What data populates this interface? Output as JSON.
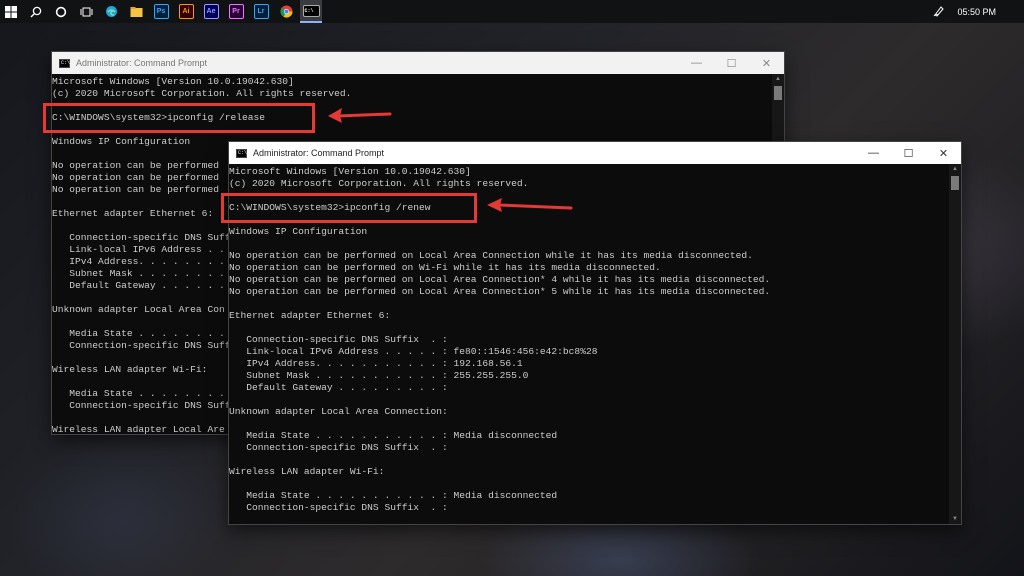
{
  "taskbar": {
    "icons": [
      {
        "name": "windows-start-icon",
        "label": ""
      },
      {
        "name": "search-icon",
        "label": ""
      },
      {
        "name": "cortana-icon",
        "label": ""
      },
      {
        "name": "task-view-icon",
        "label": ""
      },
      {
        "name": "edge-icon",
        "label": ""
      },
      {
        "name": "file-explorer-icon",
        "label": ""
      },
      {
        "name": "photoshop-icon",
        "label": "Ps",
        "color": "#31a8ff",
        "bg": "#001e36"
      },
      {
        "name": "illustrator-icon",
        "label": "Ai",
        "color": "#ff9a00",
        "bg": "#330000"
      },
      {
        "name": "after-effects-icon",
        "label": "Ae",
        "color": "#9999ff",
        "bg": "#00005b"
      },
      {
        "name": "premiere-icon",
        "label": "Pr",
        "color": "#9999ff",
        "bg": "#2a0034"
      },
      {
        "name": "lightroom-icon",
        "label": "Lr",
        "color": "#31a8ff",
        "bg": "#001e36"
      },
      {
        "name": "chrome-icon",
        "label": ""
      },
      {
        "name": "command-prompt-icon",
        "label": "C:\\"
      }
    ],
    "clock": "05:50 PM"
  },
  "window_back": {
    "title": "Administrator: Command Prompt",
    "lines": [
      "Microsoft Windows [Version 10.0.19042.630]",
      "(c) 2020 Microsoft Corporation. All rights reserved.",
      "",
      "C:\\WINDOWS\\system32>ipconfig /release",
      "",
      "Windows IP Configuration",
      "",
      "No operation can be performed",
      "No operation can be performed",
      "No operation can be performed",
      "",
      "Ethernet adapter Ethernet 6:",
      "",
      "   Connection-specific DNS Suff",
      "   Link-local IPv6 Address . . .",
      "   IPv4 Address. . . . . . . . .",
      "   Subnet Mask . . . . . . . . .",
      "   Default Gateway . . . . . . .",
      "",
      "Unknown adapter Local Area Con",
      "",
      "   Media State . . . . . . . . .",
      "   Connection-specific DNS Suff",
      "",
      "Wireless LAN adapter Wi-Fi:",
      "",
      "   Media State . . . . . . . . .",
      "   Connection-specific DNS Suff",
      "",
      "Wireless LAN adapter Local Are"
    ]
  },
  "window_front": {
    "title": "Administrator: Command Prompt",
    "lines": [
      "Microsoft Windows [Version 10.0.19042.630]",
      "(c) 2020 Microsoft Corporation. All rights reserved.",
      "",
      "C:\\WINDOWS\\system32>ipconfig /renew",
      "",
      "Windows IP Configuration",
      "",
      "No operation can be performed on Local Area Connection while it has its media disconnected.",
      "No operation can be performed on Wi-Fi while it has its media disconnected.",
      "No operation can be performed on Local Area Connection* 4 while it has its media disconnected.",
      "No operation can be performed on Local Area Connection* 5 while it has its media disconnected.",
      "",
      "Ethernet adapter Ethernet 6:",
      "",
      "   Connection-specific DNS Suffix  . :",
      "   Link-local IPv6 Address . . . . . : fe80::1546:456:e42:bc8%28",
      "   IPv4 Address. . . . . . . . . . . : 192.168.56.1",
      "   Subnet Mask . . . . . . . . . . . : 255.255.255.0",
      "   Default Gateway . . . . . . . . . :",
      "",
      "Unknown adapter Local Area Connection:",
      "",
      "   Media State . . . . . . . . . . . : Media disconnected",
      "   Connection-specific DNS Suffix  . :",
      "",
      "Wireless LAN adapter Wi-Fi:",
      "",
      "   Media State . . . . . . . . . . . : Media disconnected",
      "   Connection-specific DNS Suffix  . :"
    ]
  },
  "annotation_color": "#e53935"
}
